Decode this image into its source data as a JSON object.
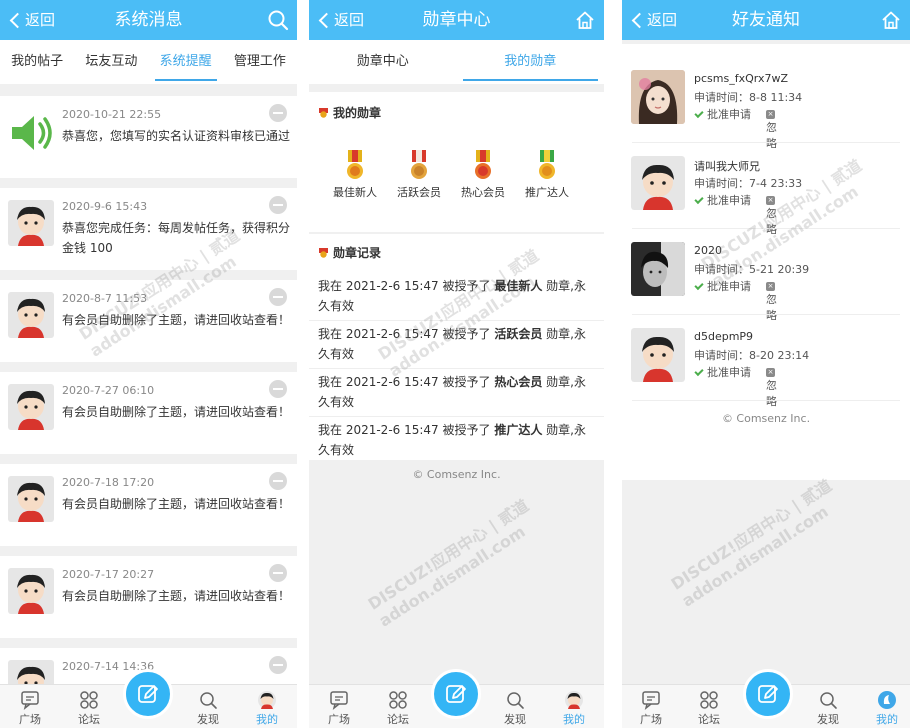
{
  "panel1": {
    "header": {
      "back_label": "返回",
      "title": "系统消息"
    },
    "tabs": [
      {
        "label": "我的帖子"
      },
      {
        "label": "坛友互动"
      },
      {
        "label": "系统提醒"
      },
      {
        "label": "管理工作"
      }
    ],
    "notices": [
      {
        "time": "2020-10-21 22:55",
        "text": "恭喜您，您填写的实名认证资料审核已通过"
      },
      {
        "time": "2020-9-6 15:43",
        "text": "恭喜您完成任务：每周发帖任务，获得积分 金钱 100"
      },
      {
        "time": "2020-8-7 11:53",
        "text": "有会员自助删除了主题，请进回收站查看！"
      },
      {
        "time": "2020-7-27 06:10",
        "text": "有会员自助删除了主题，请进回收站查看！"
      },
      {
        "time": "2020-7-18 17:20",
        "text": "有会员自助删除了主题，请进回收站查看！"
      },
      {
        "time": "2020-7-17 20:27",
        "text": "有会员自助删除了主题，请进回收站查看！"
      },
      {
        "time": "2020-7-14 14:36",
        "text": ""
      }
    ]
  },
  "panel2": {
    "header": {
      "back_label": "返回",
      "title": "勋章中心"
    },
    "tabs": [
      {
        "label": "勋章中心"
      },
      {
        "label": "我的勋章"
      }
    ],
    "my_medals_title": "我的勋章",
    "medals": [
      {
        "name": "最佳新人",
        "ribbon_color": "#e3b21a"
      },
      {
        "name": "活跃会员",
        "ribbon_color": "#d8392b"
      },
      {
        "name": "热心会员",
        "ribbon_color": "#e3b21a"
      },
      {
        "name": "推广达人",
        "ribbon_color": "#3aa845"
      }
    ],
    "records_title": "勋章记录",
    "records": [
      {
        "prefix": "我在 2021-2-6 15:47 被授予了 ",
        "medal": "最佳新人",
        "suffix": " 勋章,永久有效"
      },
      {
        "prefix": "我在 2021-2-6 15:47 被授予了 ",
        "medal": "活跃会员",
        "suffix": " 勋章,永久有效"
      },
      {
        "prefix": "我在 2021-2-6 15:47 被授予了 ",
        "medal": "热心会员",
        "suffix": " 勋章,永久有效"
      },
      {
        "prefix": "我在 2021-2-6 15:47 被授予了 ",
        "medal": "推广达人",
        "suffix": " 勋章,永久有效"
      }
    ],
    "copyright": "© Comsenz Inc."
  },
  "panel3": {
    "header": {
      "back_label": "返回",
      "title": "好友通知"
    },
    "friends": [
      {
        "name": "pcsms_fxQrx7wZ",
        "time": "申请时间：8-8 11:34",
        "approve": "批准申请",
        "ignore": "忽略"
      },
      {
        "name": "请叫我大师兄",
        "time": "申请时间：7-4 23:33",
        "approve": "批准申请",
        "ignore": "忽略"
      },
      {
        "name": "2020",
        "time": "申请时间：5-21 20:39",
        "approve": "批准申请",
        "ignore": "忽略"
      },
      {
        "name": "d5depmP9",
        "time": "申请时间：8-20 23:14",
        "approve": "批准申请",
        "ignore": "忽略"
      }
    ],
    "copyright": "© Comsenz Inc."
  },
  "bottom_nav": {
    "items": [
      {
        "label": "广场",
        "icon": "chat-bubble-icon"
      },
      {
        "label": "论坛",
        "icon": "grid-icon"
      },
      {
        "label": "发现",
        "icon": "search-icon"
      },
      {
        "label": "我的",
        "icon": "avatar-icon"
      }
    ],
    "post_icon": "edit-icon"
  },
  "watermark": {
    "brand": "DISCUZ!应用中心 | 贰道",
    "domain": "addon.dismall.com"
  },
  "colors": {
    "header": "#4bbdf6",
    "accent": "#3fa7e8",
    "approve_green": "#4cae4c"
  }
}
